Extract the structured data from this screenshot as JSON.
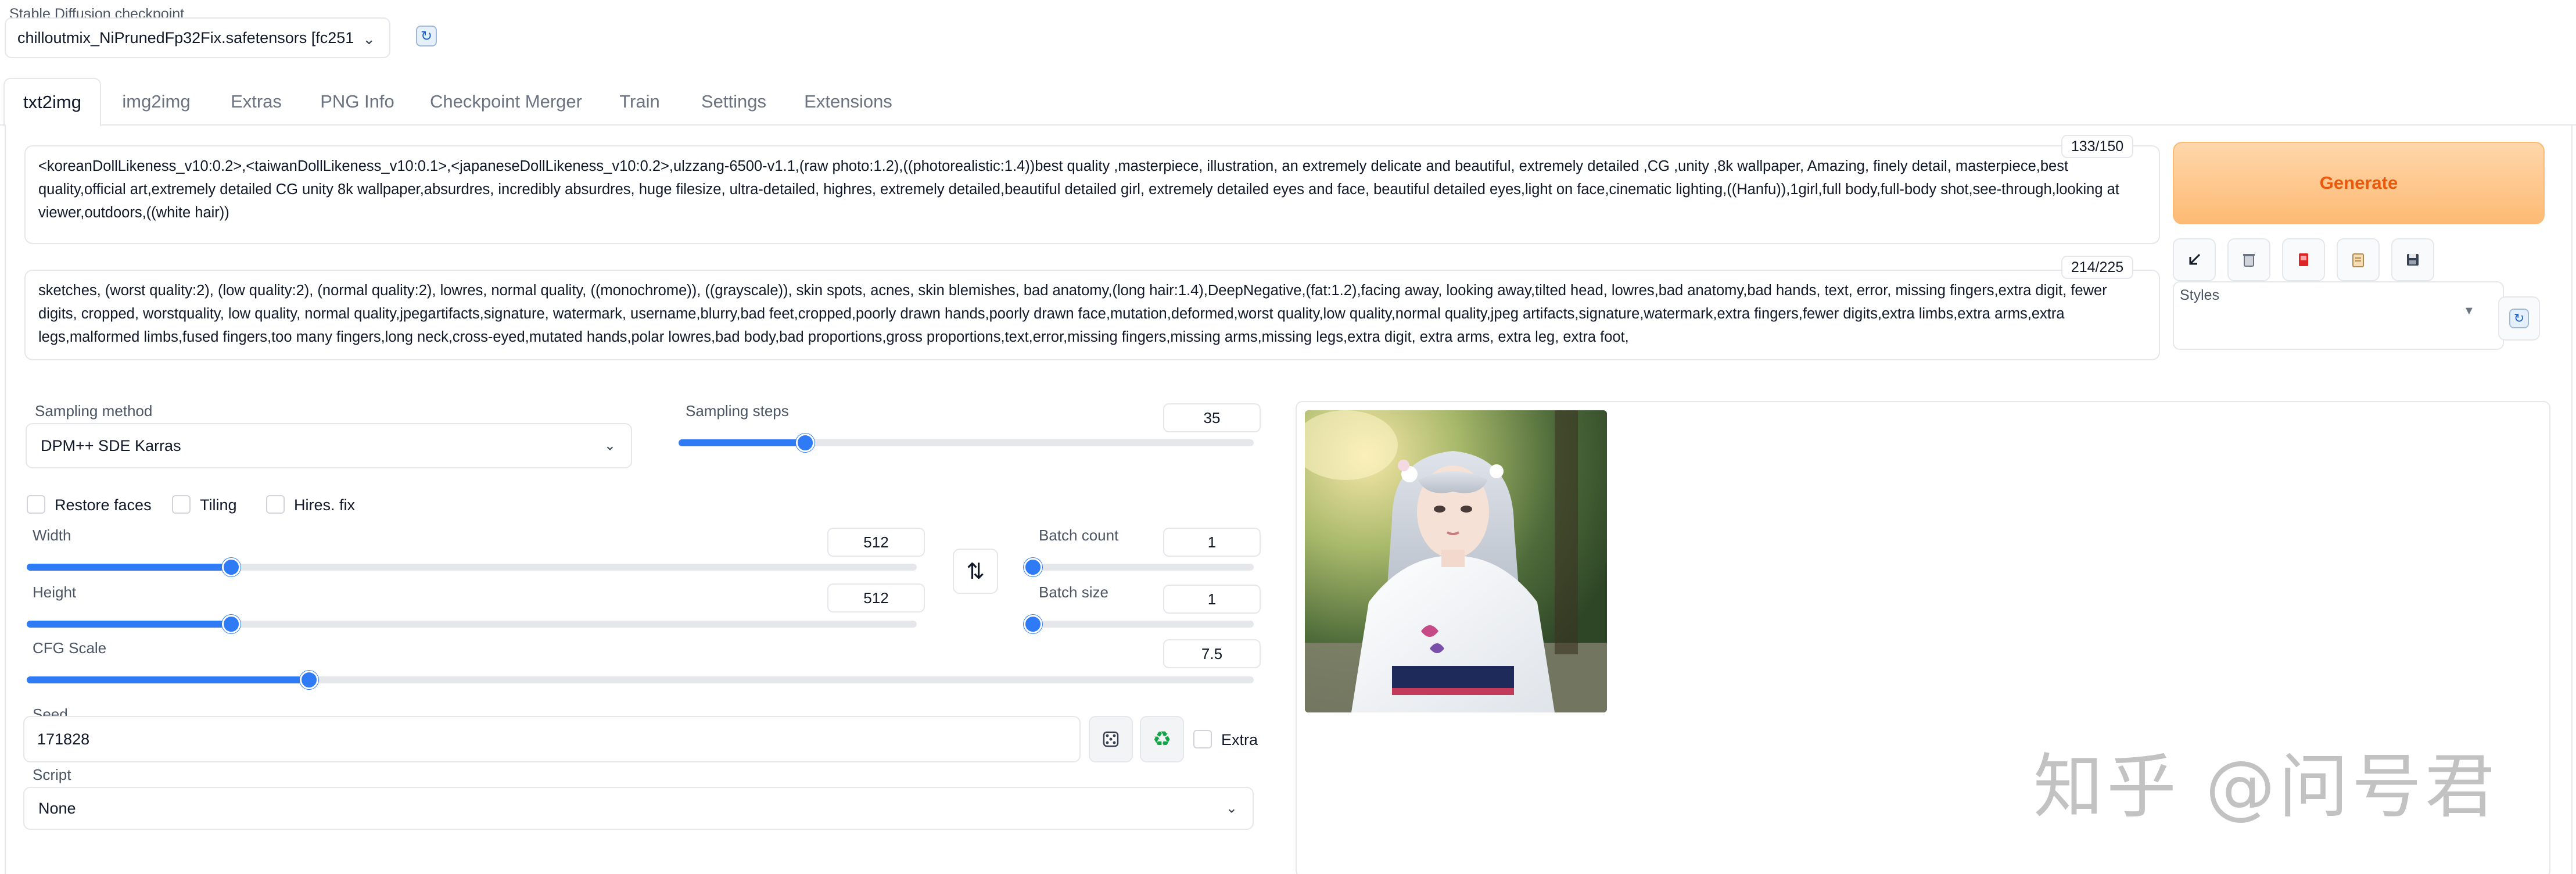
{
  "checkpoint": {
    "label": "Stable Diffusion checkpoint",
    "value": "chilloutmix_NiPrunedFp32Fix.safetensors [fc251",
    "refresh_icon": "refresh-icon"
  },
  "tabs": [
    {
      "label": "txt2img",
      "active": true
    },
    {
      "label": "img2img"
    },
    {
      "label": "Extras"
    },
    {
      "label": "PNG Info"
    },
    {
      "label": "Checkpoint Merger"
    },
    {
      "label": "Train"
    },
    {
      "label": "Settings"
    },
    {
      "label": "Extensions"
    }
  ],
  "prompt": {
    "counter": "133/150",
    "text": "<koreanDollLikeness_v10:0.2>,<taiwanDollLikeness_v10:0.1>,<japaneseDollLikeness_v10:0.2>,ulzzang-6500-v1.1,(raw photo:1.2),((photorealistic:1.4))best quality ,masterpiece, illustration, an extremely delicate and beautiful, extremely detailed ,CG ,unity ,8k wallpaper, Amazing, finely detail, masterpiece,best quality,official art,extremely detailed CG unity 8k wallpaper,absurdres, incredibly absurdres, huge filesize, ultra-detailed, highres, extremely detailed,beautiful detailed girl, extremely detailed eyes and face, beautiful detailed eyes,light on face,cinematic lighting,((Hanfu)),1girl,full body,full-body shot,see-through,looking at viewer,outdoors,((white hair))"
  },
  "negative_prompt": {
    "counter": "214/225",
    "text": "sketches, (worst quality:2), (low quality:2), (normal quality:2), lowres, normal quality, ((monochrome)), ((grayscale)), skin spots, acnes, skin blemishes, bad anatomy,(long hair:1.4),DeepNegative,(fat:1.2),facing away, looking away,tilted head, lowres,bad anatomy,bad hands, text, error, missing fingers,extra digit, fewer digits, cropped, worstquality, low quality, normal quality,jpegartifacts,signature, watermark, username,blurry,bad feet,cropped,poorly drawn hands,poorly drawn face,mutation,deformed,worst quality,low quality,normal quality,jpeg artifacts,signature,watermark,extra fingers,fewer digits,extra limbs,extra arms,extra legs,malformed limbs,fused fingers,too many fingers,long neck,cross-eyed,mutated hands,polar lowres,bad body,bad proportions,gross proportions,text,error,missing fingers,missing arms,missing legs,extra digit, extra arms, extra leg, extra foot,"
  },
  "actions": {
    "generate_label": "Generate",
    "tools": [
      "arrow-icon",
      "trash-icon",
      "red-card-icon",
      "clipboard-icon",
      "save-icon"
    ]
  },
  "styles": {
    "label": "Styles",
    "value": ""
  },
  "sampling": {
    "method_label": "Sampling method",
    "method_value": "DPM++ SDE Karras",
    "steps_label": "Sampling steps",
    "steps_value": "35",
    "steps_fraction": 0.22
  },
  "checkboxes": [
    {
      "label": "Restore faces",
      "checked": false
    },
    {
      "label": "Tiling",
      "checked": false
    },
    {
      "label": "Hires. fix",
      "checked": false
    }
  ],
  "width": {
    "label": "Width",
    "value": "512",
    "fraction": 0.23
  },
  "height": {
    "label": "Height",
    "value": "512",
    "fraction": 0.23
  },
  "batch_count": {
    "label": "Batch count",
    "value": "1",
    "fraction": 0.0
  },
  "batch_size": {
    "label": "Batch size",
    "value": "1",
    "fraction": 0.0
  },
  "cfg": {
    "label": "CFG Scale",
    "value": "7.5",
    "fraction": 0.23
  },
  "seed": {
    "label": "Seed",
    "value": "171828",
    "extra_label": "Extra",
    "dice_icon": "dice-icon",
    "recycle_icon": "recycle-icon"
  },
  "script": {
    "label": "Script",
    "value": "None"
  },
  "watermark": "知乎 @问号君",
  "colors": {
    "accent": "#2f7bf5",
    "generate_bg": "#fdba74",
    "generate_text": "#ea580c"
  }
}
